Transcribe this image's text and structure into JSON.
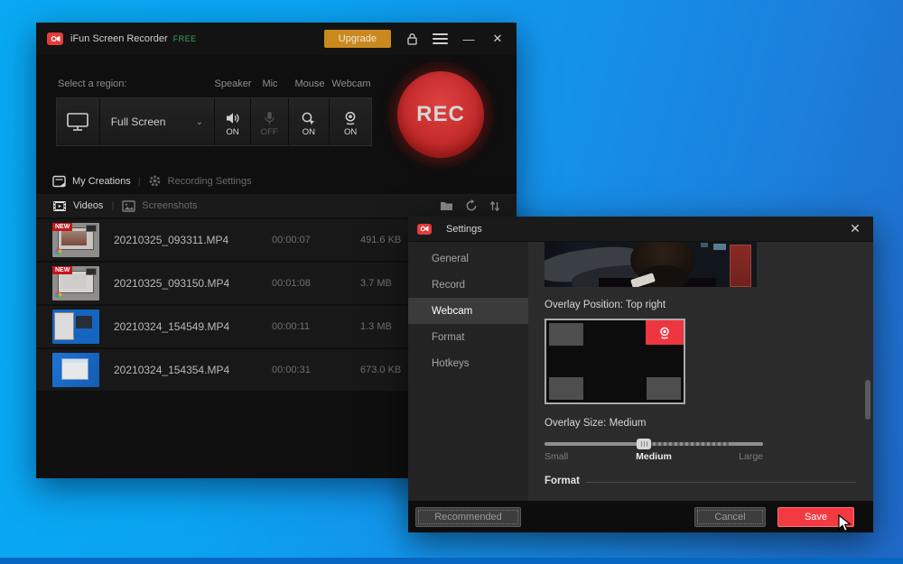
{
  "main_window": {
    "title": "iFun Screen Recorder",
    "license_badge": "FREE",
    "upgrade_label": "Upgrade",
    "region_label": "Select a region:",
    "region_selected": "Full Screen",
    "toggles": [
      {
        "label": "Speaker",
        "state": "ON"
      },
      {
        "label": "Mic",
        "state": "OFF"
      },
      {
        "label": "Mouse",
        "state": "ON"
      },
      {
        "label": "Webcam",
        "state": "ON"
      }
    ],
    "rec_label": "REC",
    "nav": {
      "my_creations": "My Creations",
      "recording_settings": "Recording Settings"
    },
    "library_tabs": {
      "videos": "Videos",
      "screenshots": "Screenshots"
    },
    "files": [
      {
        "badge": "NEW",
        "name": "20210325_093311.MP4",
        "duration": "00:00:07",
        "size": "491.6 KB"
      },
      {
        "badge": "NEW",
        "name": "20210325_093150.MP4",
        "duration": "00:01:08",
        "size": "3.7 MB"
      },
      {
        "name": "20210324_154549.MP4",
        "duration": "00:00:11",
        "size": "1.3 MB"
      },
      {
        "name": "20210324_154354.MP4",
        "duration": "00:00:31",
        "size": "673.0 KB"
      }
    ]
  },
  "settings_dialog": {
    "title": "Settings",
    "sidebar": [
      {
        "label": "General"
      },
      {
        "label": "Record"
      },
      {
        "label": "Webcam"
      },
      {
        "label": "Format"
      },
      {
        "label": "Hotkeys"
      }
    ],
    "selected_tab": "Webcam",
    "overlay_position_label": "Overlay Position: Top right",
    "overlay_size_label": "Overlay Size: Medium",
    "slider": {
      "labels": [
        "Small",
        "Medium",
        "Large"
      ],
      "value": "Medium"
    },
    "format_section_label": "Format",
    "footer": {
      "recommended": "Recommended",
      "cancel": "Cancel",
      "save": "Save"
    }
  },
  "colors": {
    "accent_red": "#f23b41",
    "upgrade_orange": "#c9891e",
    "free_green": "#3fa05c",
    "desktop_blue": "#0f9bee"
  }
}
